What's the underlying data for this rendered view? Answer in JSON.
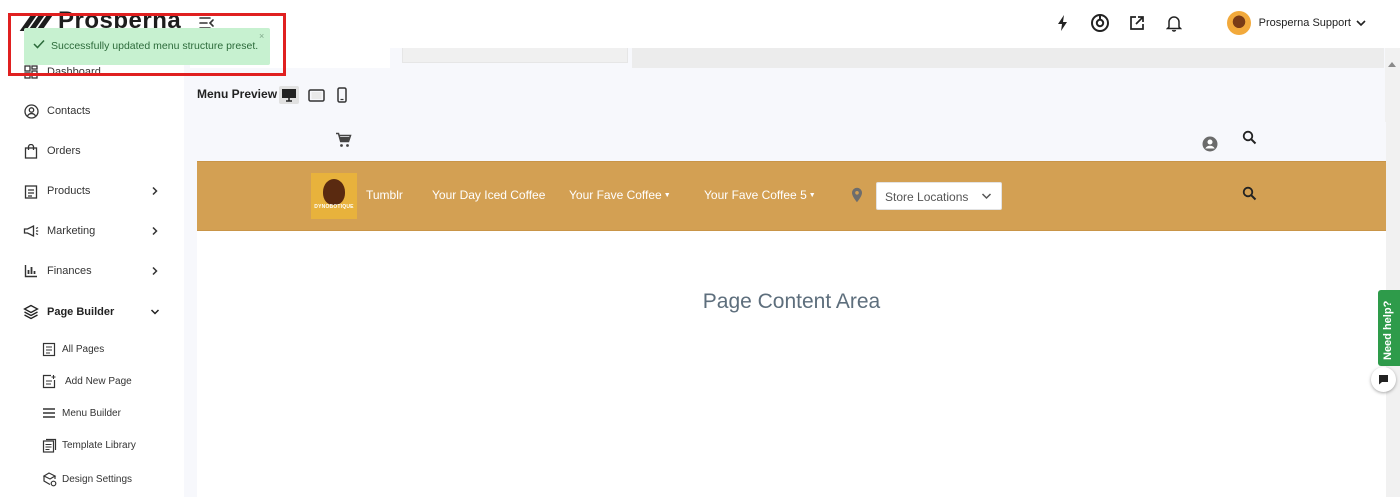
{
  "app": {
    "logo_text": "Prosperna"
  },
  "header": {
    "user_name": "Prosperna Support",
    "icons": [
      "lightning-icon",
      "donut-chart-icon",
      "external-link-icon",
      "bell-icon"
    ]
  },
  "toast": {
    "message": "Successfully updated menu structure preset.",
    "close": "×",
    "color": "#c7f1d0",
    "highlight_color": "#e02020"
  },
  "sidebar": {
    "items": [
      {
        "label": "Dashboard",
        "icon": "dashboard-grid-icon"
      },
      {
        "label": "Contacts",
        "icon": "user-circle-icon"
      },
      {
        "label": "Orders",
        "icon": "shopping-bag-icon"
      },
      {
        "label": "Products",
        "icon": "clipboard-list-icon"
      },
      {
        "label": "Marketing",
        "icon": "megaphone-icon"
      },
      {
        "label": "Finances",
        "icon": "bar-chart-icon"
      },
      {
        "label": "Page Builder",
        "icon": "layers-icon"
      }
    ],
    "page_builder_sub": [
      {
        "label": "All Pages",
        "icon": "document-icon"
      },
      {
        "label": "Add New Page",
        "icon": "document-add-icon"
      },
      {
        "label": "Menu Builder",
        "icon": "menu-lines-icon"
      },
      {
        "label": "Template Library",
        "icon": "template-icon"
      },
      {
        "label": "Design Settings",
        "icon": "design-palette-icon"
      }
    ]
  },
  "preview": {
    "title": "Menu Preview",
    "devices": [
      "desktop-icon",
      "tablet-icon",
      "mobile-icon"
    ],
    "active_device": "desktop",
    "menu": {
      "logo_text": "DYNOBOTIQUE",
      "links": [
        {
          "label": "Tumblr",
          "has_dropdown": false
        },
        {
          "label": "Your Day Iced Coffee",
          "has_dropdown": false
        },
        {
          "label": "Your Fave Coffee",
          "has_dropdown": true
        },
        {
          "label": "Your Fave Coffee 5",
          "has_dropdown": true
        }
      ],
      "store_select": "Store Locations",
      "band_color": "#d3a053"
    },
    "content_title": "Page Content Area"
  },
  "help": {
    "label": "Need help?",
    "color": "#2e9b4a"
  }
}
